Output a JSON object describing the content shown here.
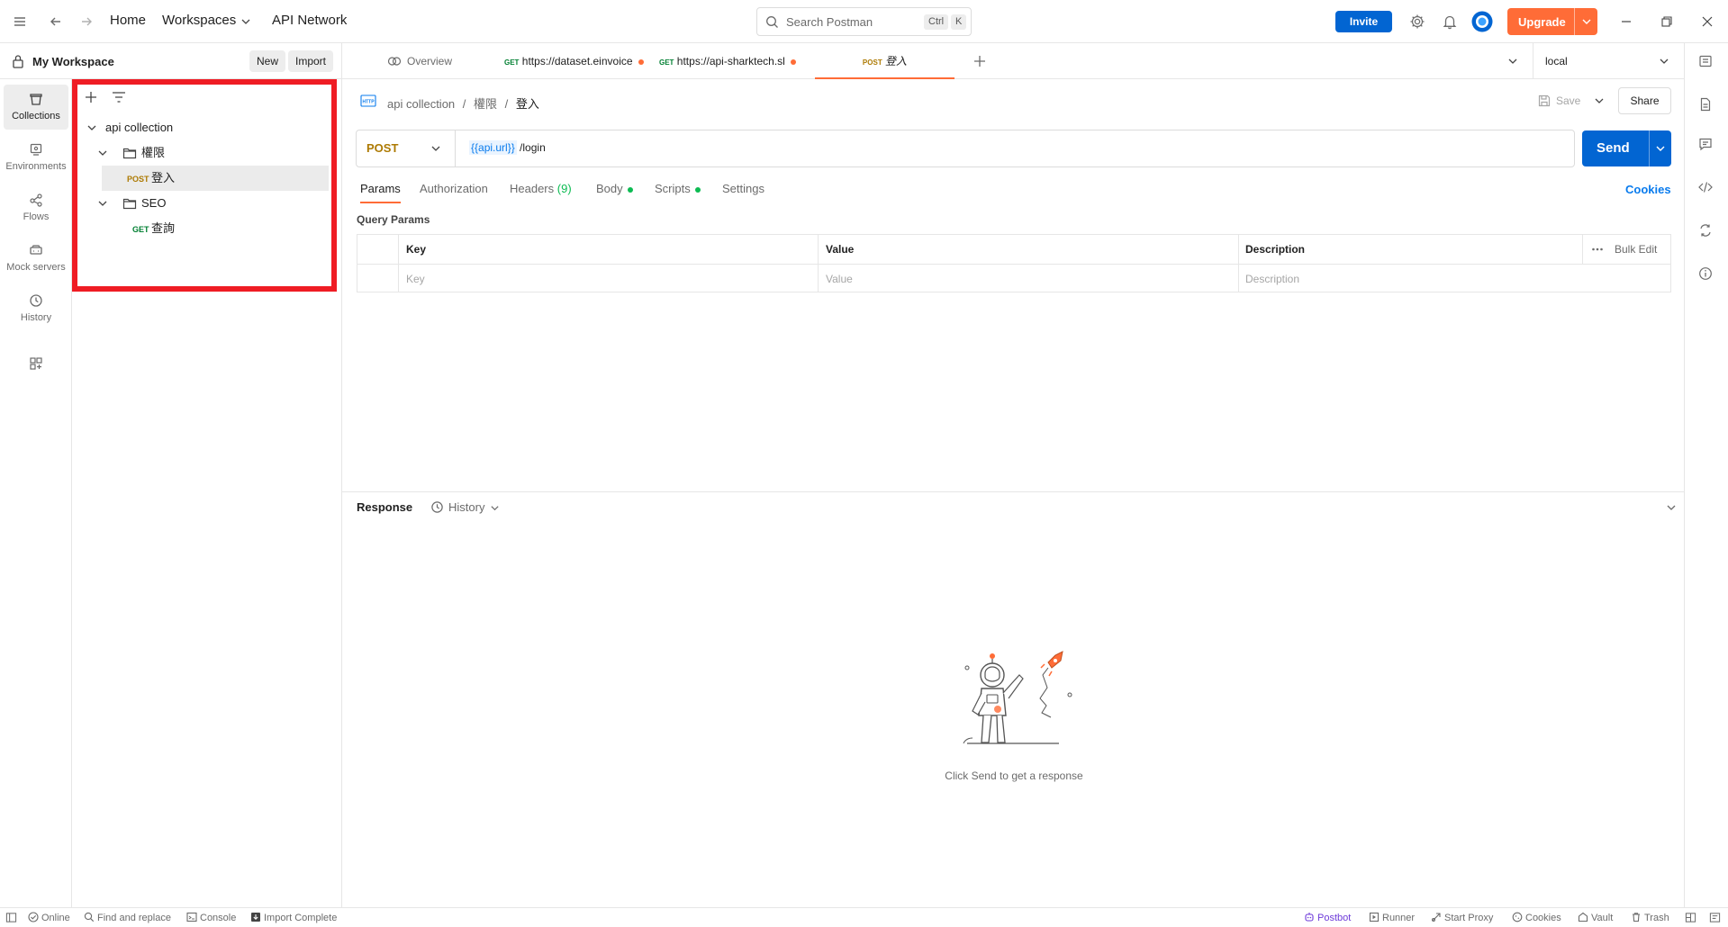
{
  "topbar": {
    "home": "Home",
    "workspaces": "Workspaces",
    "api_network": "API Network",
    "search_placeholder": "Search Postman",
    "kbd_ctrl": "Ctrl",
    "kbd_k": "K",
    "invite": "Invite",
    "upgrade": "Upgrade"
  },
  "workspace": {
    "name": "My Workspace",
    "new": "New",
    "import": "Import"
  },
  "rail": {
    "collections": "Collections",
    "environments": "Environments",
    "flows": "Flows",
    "mock_servers": "Mock servers",
    "history": "History"
  },
  "tree": {
    "collection": "api collection",
    "folder1": "權限",
    "req1_method": "POST",
    "req1_name": "登入",
    "folder2": "SEO",
    "req2_method": "GET",
    "req2_name": "查詢"
  },
  "tabs": {
    "overview": "Overview",
    "tab2_method": "GET",
    "tab2_url": "https://dataset.einvoice",
    "tab3_method": "GET",
    "tab3_url": "https://api-sharktech.sl",
    "tab4_method": "POST",
    "tab4_name": "登入",
    "environment": "local"
  },
  "request": {
    "breadcrumb_collection": "api collection",
    "breadcrumb_folder": "權限",
    "breadcrumb_name": "登入",
    "save": "Save",
    "share": "Share",
    "method": "POST",
    "url_var": "{{api.url}}",
    "url_path": " /login",
    "send": "Send",
    "tab_params": "Params",
    "tab_authorization": "Authorization",
    "tab_headers": "Headers",
    "headers_count": "(9)",
    "tab_body": "Body",
    "tab_scripts": "Scripts",
    "tab_settings": "Settings",
    "cookies": "Cookies",
    "query_params": "Query Params"
  },
  "params_table": {
    "col_key": "Key",
    "col_value": "Value",
    "col_description": "Description",
    "bulk_edit": "Bulk Edit",
    "key_placeholder": "Key",
    "value_placeholder": "Value",
    "description_placeholder": "Description"
  },
  "response": {
    "title": "Response",
    "history": "History",
    "empty_message": "Click Send to get a response"
  },
  "statusbar": {
    "online": "Online",
    "find_replace": "Find and replace",
    "console": "Console",
    "import_complete": "Import Complete",
    "postbot": "Postbot",
    "runner": "Runner",
    "start_proxy": "Start Proxy",
    "cookies": "Cookies",
    "vault": "Vault",
    "trash": "Trash"
  },
  "colors": {
    "accent": "#ff6c37",
    "primary_blue": "#0265d2",
    "highlight_red": "#ef1c24",
    "post_method": "#ad7a03",
    "get_method": "#007f31"
  }
}
